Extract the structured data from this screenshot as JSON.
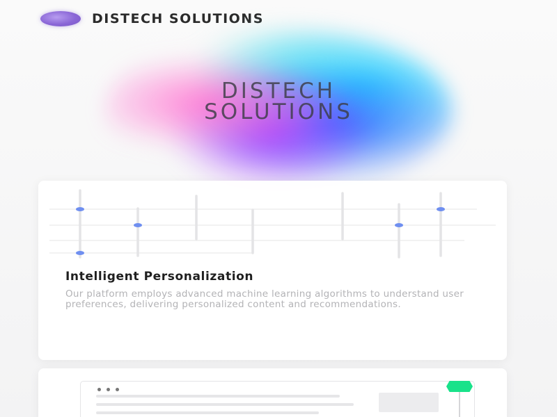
{
  "header": {
    "logo_icon": "purple-oval-logo",
    "brand": "DISTECH SOLUTIONS"
  },
  "hero": {
    "title_line1": "DISTECH",
    "title_line2": "SOLUTIONS"
  },
  "feature_card": {
    "title": "Intelligent Personalization",
    "description": "Our platform employs advanced machine learning algorithms to understand user preferences, delivering personalized content and recommendations.",
    "viz_icon": "data-points-grid-graphic",
    "accent_color": "#6f8ff0"
  },
  "preview_card": {
    "window_icon": "window-mockup",
    "badge_color": "#19e28a"
  }
}
